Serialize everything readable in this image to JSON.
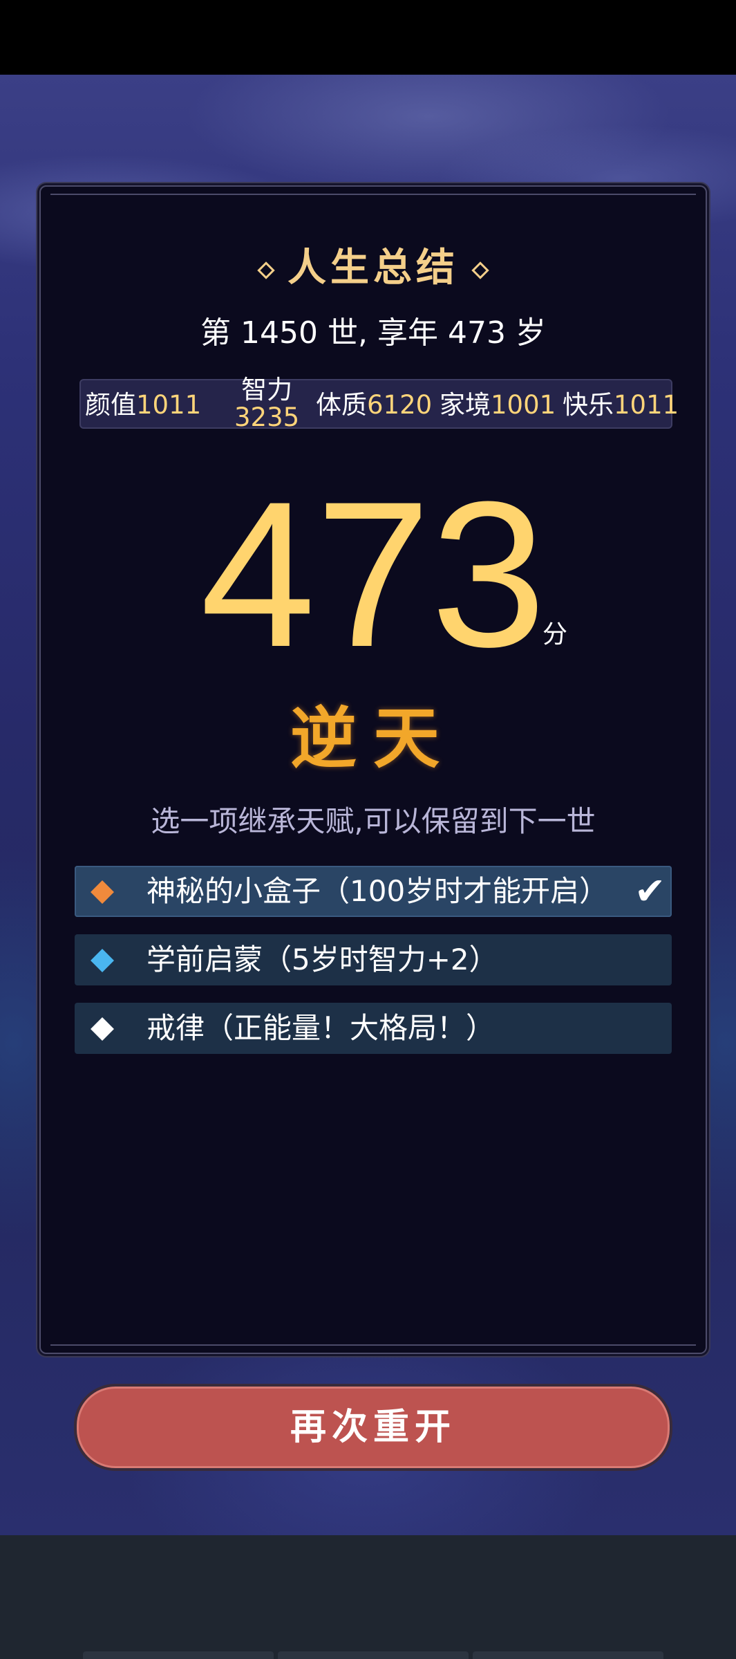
{
  "summary": {
    "title": "人生总结",
    "subtitle": "第 1450 世, 享年 473 岁"
  },
  "stats": [
    {
      "label": "颜值",
      "value": "1011"
    },
    {
      "label": "智力",
      "value": "3235"
    },
    {
      "label": "体质",
      "value": "6120"
    },
    {
      "label": "家境",
      "value": "1001"
    },
    {
      "label": "快乐",
      "value": "1011"
    }
  ],
  "score": {
    "value": "473",
    "unit": "分",
    "grade": "逆天"
  },
  "inherit": {
    "prompt": "选一项继承天赋,可以保留到下一世",
    "talents": [
      {
        "label": "神秘的小盒子（100岁时才能开启）",
        "gem_color": "#f08a3c",
        "selected": true
      },
      {
        "label": "学前启蒙（5岁时智力+2）",
        "gem_color": "#4ab6f0",
        "selected": false
      },
      {
        "label": "戒律（正能量！大格局！）",
        "gem_color": "#ffffff",
        "selected": false
      }
    ]
  },
  "restart_button": "再次重开",
  "colors": {
    "accent": "#ffd46e",
    "button": "#bd5350",
    "panel": "#0b0a1e"
  }
}
